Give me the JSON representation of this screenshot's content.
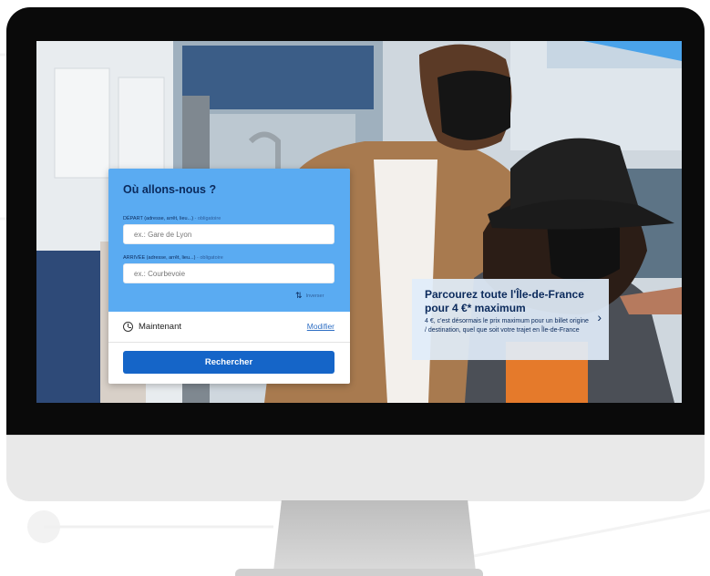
{
  "search": {
    "title": "Où allons-nous ?",
    "departure_label": "DÉPART (adresse, arrêt, lieu...)",
    "departure_required": " - obligatoire",
    "departure_placeholder": "ex.: Gare de Lyon",
    "arrival_label": "ARRIVÉE (adresse, arrêt, lieu...)",
    "arrival_required": " - obligatoire",
    "arrival_placeholder": "ex.: Courbevoie",
    "swap_label": "Inverser",
    "time_label": "Maintenant",
    "modify_label": "Modifier",
    "search_button": "Rechercher"
  },
  "promo": {
    "title": "Parcourez toute l'Île-de-France pour 4 €* maximum",
    "text": "4 €, c'est désormais le prix maximum pour un billet origine / destination, quel que soit votre trajet en Île-de-France"
  },
  "colors": {
    "card_header": "#5aabf2",
    "button": "#1565c8",
    "title_text": "#0b2a5c"
  }
}
